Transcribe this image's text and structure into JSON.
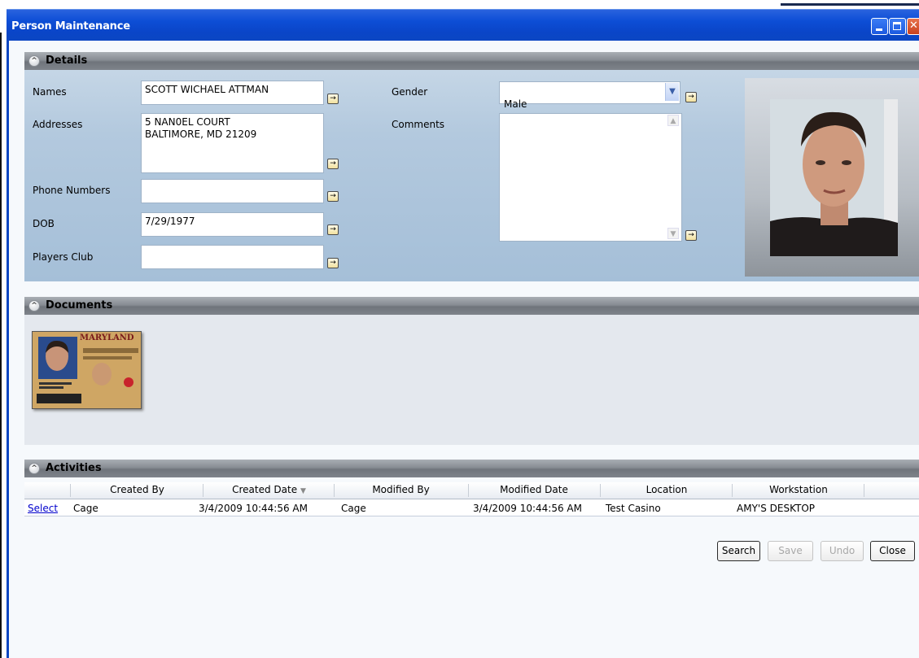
{
  "window": {
    "title": "Person Maintenance"
  },
  "details": {
    "header": "Details",
    "labels": {
      "names": "Names",
      "addresses": "Addresses",
      "phone": "Phone Numbers",
      "dob": "DOB",
      "players_club": "Players Club",
      "gender": "Gender",
      "comments": "Comments"
    },
    "values": {
      "names": "SCOTT WICHAEL ATTMAN",
      "addresses": "5 NAN0EL COURT\nBALTIMORE, MD 21209",
      "phone": "",
      "dob": "7/29/1977",
      "players_club": "",
      "gender": "Male",
      "comments": ""
    }
  },
  "documents": {
    "header": "Documents",
    "thumb_heading": "MARYLAND"
  },
  "activities": {
    "header": "Activities",
    "columns": [
      "Created By",
      "Created Date",
      "Modified By",
      "Modified Date",
      "Location",
      "Workstation"
    ],
    "rows": [
      {
        "action": "Select",
        "created_by": "Cage",
        "created_date": "3/4/2009 10:44:56 AM",
        "modified_by": "Cage",
        "modified_date": "3/4/2009 10:44:56 AM",
        "location": "Test Casino",
        "workstation": "AMY'S DESKTOP"
      }
    ]
  },
  "buttons": {
    "search": "Search",
    "save": "Save",
    "undo": "Undo",
    "close": "Close"
  }
}
